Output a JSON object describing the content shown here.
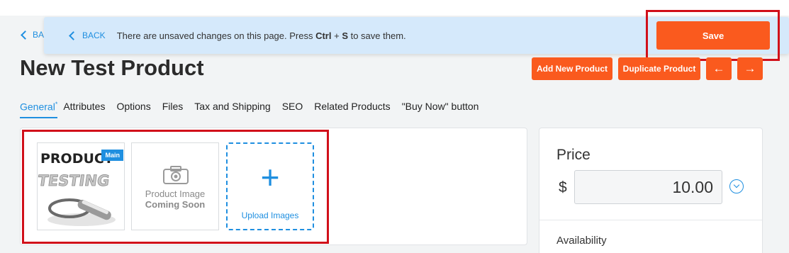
{
  "back_link": {
    "label": "BACK",
    "partial_label": "BA"
  },
  "banner": {
    "back_label": "BACK",
    "message_pre": "There are unsaved changes on this page. Press ",
    "key_ctrl": "Ctrl",
    "plus": " + ",
    "key_s": "S",
    "message_post": " to save them.",
    "save_label": "Save"
  },
  "product": {
    "title": "New Test Product"
  },
  "header_actions": {
    "add_new_label": "Add New Product",
    "duplicate_label": "Duplicate Product",
    "prev_glyph": "←",
    "next_glyph": "→"
  },
  "tabs": [
    {
      "label": "General",
      "marker": "*"
    },
    {
      "label": "Attributes"
    },
    {
      "label": "Options"
    },
    {
      "label": "Files"
    },
    {
      "label": "Tax and Shipping"
    },
    {
      "label": "SEO"
    },
    {
      "label": "Related Products"
    },
    {
      "label": "\"Buy Now\" button"
    }
  ],
  "images": {
    "main_badge": "Main",
    "main_image_text_line1": "PRODUCT",
    "main_image_text_line2": "TESTING",
    "placeholder_line1": "Product Image",
    "placeholder_line2": "Coming Soon",
    "upload_label": "Upload Images"
  },
  "price_panel": {
    "title": "Price",
    "currency": "$",
    "value": "10.00",
    "availability_label": "Availability"
  },
  "colors": {
    "accent_blue": "#1f8fe0",
    "action_orange": "#fa5a1e",
    "banner_bg": "#d5e9fb",
    "highlight_red": "#d1101a"
  }
}
